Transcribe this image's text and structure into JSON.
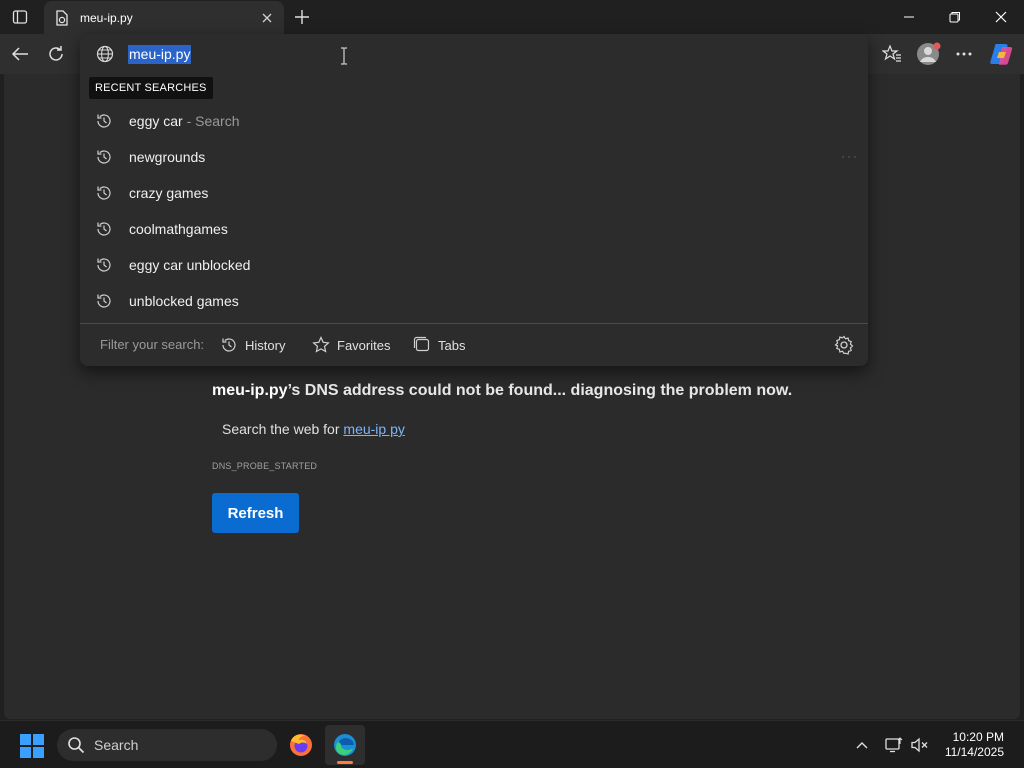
{
  "browser": {
    "tab": {
      "title": "meu-ip.py"
    },
    "address": {
      "value": "meu-ip.py"
    }
  },
  "dropdown": {
    "recent_label": "RECENT SEARCHES",
    "suggestions": [
      {
        "text": "eggy car",
        "suffix": " - Search"
      },
      {
        "text": "newgrounds",
        "suffix": ""
      },
      {
        "text": "crazy games",
        "suffix": ""
      },
      {
        "text": "coolmathgames",
        "suffix": ""
      },
      {
        "text": "eggy car unblocked",
        "suffix": ""
      },
      {
        "text": "unblocked games",
        "suffix": ""
      }
    ],
    "filter": {
      "label": "Filter your search:",
      "chips": [
        "History",
        "Favorites",
        "Tabs"
      ]
    }
  },
  "page": {
    "heading_host": "meu-ip.py",
    "heading_rest": "’s DNS address could not be found... diagnosing the problem now.",
    "search_prefix": "Search the web for ",
    "search_link": "meu-ip py",
    "error_code": "DNS_PROBE_STARTED",
    "refresh_label": "Refresh"
  },
  "taskbar": {
    "search_label": "Search",
    "time": "10:20 PM",
    "date": "11/14/2025"
  },
  "colors": {
    "accent": "#0a6bd1",
    "link": "#7cb6f6",
    "selection": "#2a64c8"
  }
}
